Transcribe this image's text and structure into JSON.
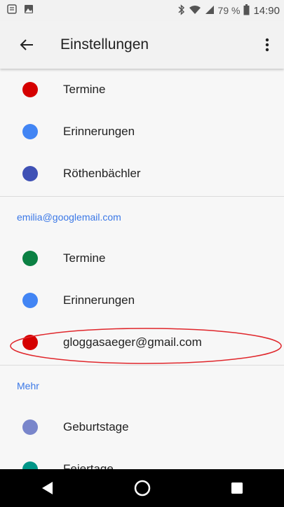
{
  "statusbar": {
    "battery_text": "79 %",
    "time": "14:90"
  },
  "appbar": {
    "title": "Einstellungen"
  },
  "calendars_top": [
    {
      "label": "Termine",
      "color": "#d50000"
    },
    {
      "label": "Erinnerungen",
      "color": "#4285f4"
    },
    {
      "label": "Röthenbächler",
      "color": "#3f51b5"
    }
  ],
  "account_section": {
    "header": "emilia@googlemail.com",
    "items": [
      {
        "label": "Termine",
        "color": "#0b8043"
      },
      {
        "label": "Erinnerungen",
        "color": "#4285f4"
      },
      {
        "label": "gloggasaeger@gmail.com",
        "color": "#d50000"
      }
    ]
  },
  "more_section": {
    "header": "Mehr",
    "items": [
      {
        "label": "Geburtstage",
        "color": "#7986cb"
      },
      {
        "label": "Feiertage",
        "color": "#009688"
      }
    ]
  },
  "annotation_color": "#e0262b"
}
